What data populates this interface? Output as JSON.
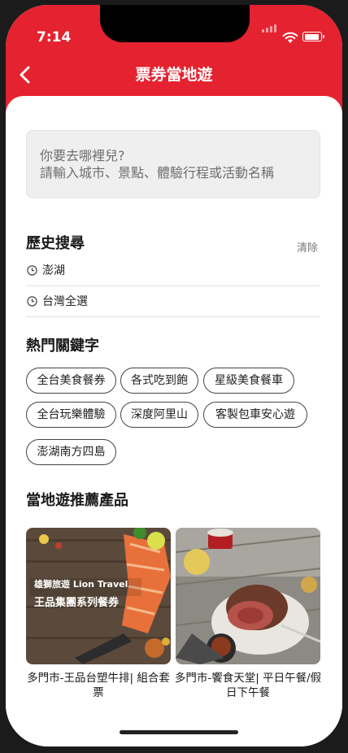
{
  "status_bar": {
    "time": "7:14"
  },
  "nav": {
    "title": "票券當地遊"
  },
  "search": {
    "line1": "你要去哪裡兒?",
    "line2": "請輸入城市、景點、體驗行程或活動名稱"
  },
  "history": {
    "title": "歷史搜尋",
    "clear_label": "清除",
    "items": [
      "澎湖",
      "台灣全選"
    ]
  },
  "hot_keywords": {
    "title": "熱門關鍵字",
    "tags": [
      "全台美食餐券",
      "各式吃到飽",
      "星級美食餐車",
      "全台玩樂體驗",
      "深度阿里山",
      "客製包車安心遊",
      "澎湖南方四島"
    ]
  },
  "recommend": {
    "title": "當地遊推薦產品",
    "products": [
      {
        "caption": "多門市-王品台塑牛排| 組合套票",
        "banner_brand": "雄獅旅遊 Lion Travel",
        "banner_text": "王品集團系列餐券"
      },
      {
        "caption": "多門市-饗食天堂| 平日午餐/假日下午餐"
      }
    ]
  }
}
